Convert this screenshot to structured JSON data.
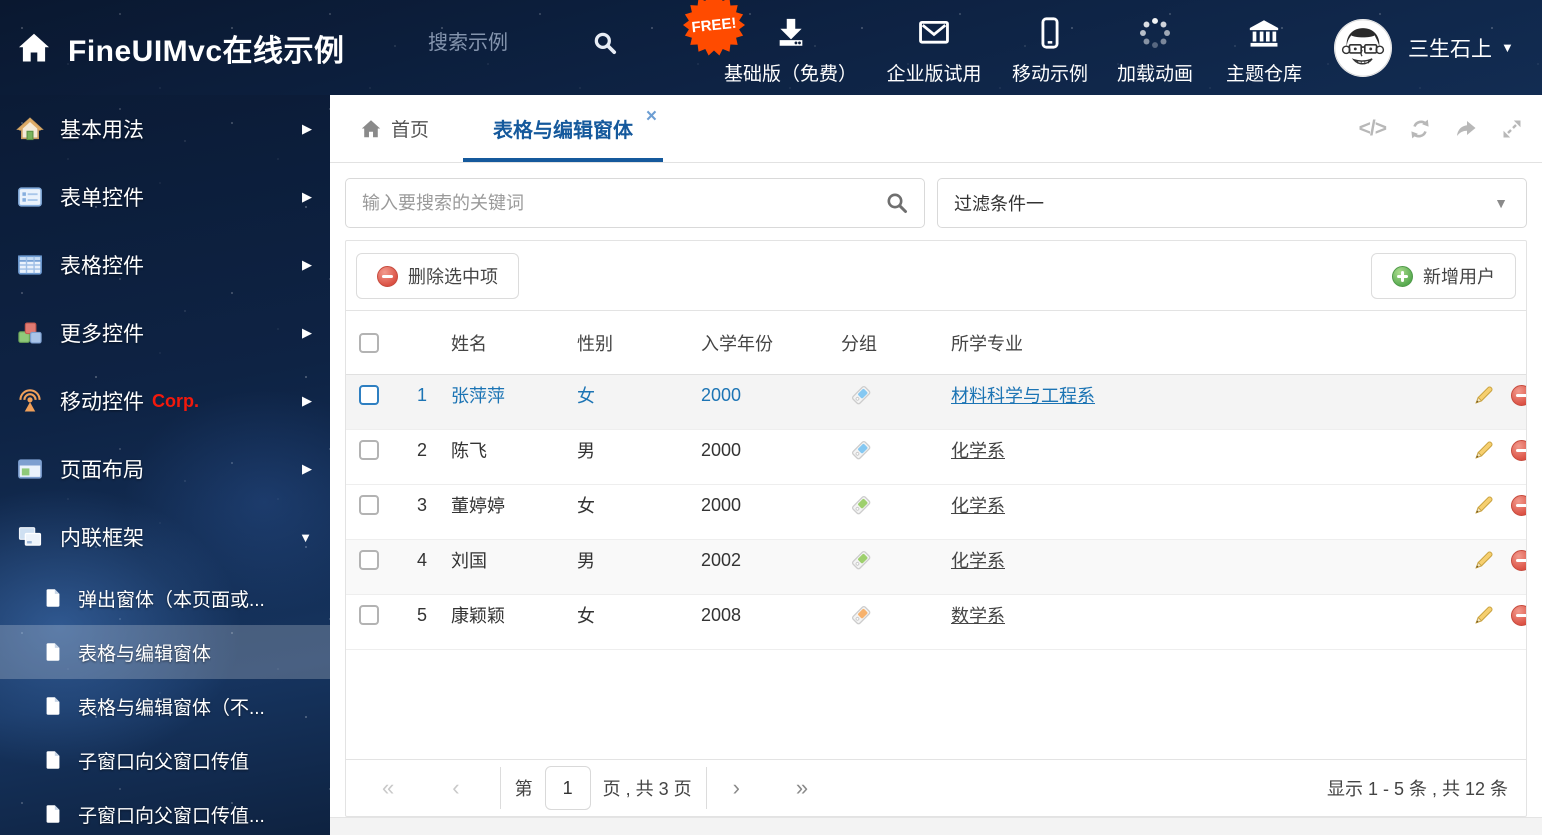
{
  "header": {
    "title": "FineUIMvc在线示例",
    "search_placeholder": "搜索示例",
    "free_badge": "FREE!",
    "nav_items": [
      {
        "label": "基础版（免费）",
        "icon": "download-icon"
      },
      {
        "label": "企业版试用",
        "icon": "mail-icon"
      },
      {
        "label": "移动示例",
        "icon": "mobile-icon"
      },
      {
        "label": "加载动画",
        "icon": "spinner-icon"
      },
      {
        "label": "主题仓库",
        "icon": "bank-icon"
      }
    ],
    "user": {
      "name": "三生石上"
    }
  },
  "sidebar": {
    "items": [
      {
        "label": "基本用法",
        "icon": "home-icon"
      },
      {
        "label": "表单控件",
        "icon": "form-icon"
      },
      {
        "label": "表格控件",
        "icon": "table-icon"
      },
      {
        "label": "更多控件",
        "icon": "cubes-icon"
      },
      {
        "label": "移动控件",
        "badge": "Corp.",
        "icon": "antenna-icon"
      },
      {
        "label": "页面布局",
        "icon": "layout-icon"
      },
      {
        "label": "内联框架",
        "icon": "frames-icon",
        "expanded": true
      }
    ],
    "subitems": [
      {
        "label": "弹出窗体（本页面或..."
      },
      {
        "label": "表格与编辑窗体",
        "active": true
      },
      {
        "label": "表格与编辑窗体（不..."
      },
      {
        "label": "子窗口向父窗口传值"
      },
      {
        "label": "子窗口向父窗口传值..."
      }
    ]
  },
  "tabs": {
    "home": "首页",
    "active": "表格与编辑窗体"
  },
  "filters": {
    "search_placeholder": "输入要搜索的关键词",
    "filter_value": "过滤条件一"
  },
  "buttons": {
    "delete_selected": "删除选中项",
    "add_user": "新增用户"
  },
  "table": {
    "columns": {
      "name": "姓名",
      "gender": "性别",
      "year": "入学年份",
      "group": "分组",
      "major": "所学专业"
    },
    "rows": [
      {
        "num": "1",
        "name": "张萍萍",
        "gender": "女",
        "year": "2000",
        "tag_color": "#85c8f2",
        "major": "材料科学与工程系",
        "selected": true
      },
      {
        "num": "2",
        "name": "陈飞",
        "gender": "男",
        "year": "2000",
        "tag_color": "#85c8f2",
        "major": "化学系"
      },
      {
        "num": "3",
        "name": "董婷婷",
        "gender": "女",
        "year": "2000",
        "tag_color": "#9ed06e",
        "major": "化学系"
      },
      {
        "num": "4",
        "name": "刘国",
        "gender": "男",
        "year": "2002",
        "tag_color": "#9ed06e",
        "major": "化学系"
      },
      {
        "num": "5",
        "name": "康颖颖",
        "gender": "女",
        "year": "2008",
        "tag_color": "#f7b26d",
        "major": "数学系"
      }
    ]
  },
  "pagination": {
    "prefix": "第",
    "current_page": "1",
    "suffix": "页 , 共 3 页",
    "summary": "显示 1 - 5 条 , 共 12 条"
  },
  "glyphs": {
    "code": "</>",
    "close": "×",
    "caret_down": "▼",
    "arrow_right": "▶",
    "pager_first": "«",
    "pager_prev": "‹",
    "pager_next": "›",
    "pager_last": "»"
  },
  "colors": {
    "accent_blue": "#15599c",
    "link_blue": "#1c74b4",
    "danger_red": "#d9534f",
    "success_green": "#5cb85c",
    "badge_orange": "#ff4b00",
    "corp_red": "#f3190c",
    "tag_blue": "#85c8f2",
    "tag_green": "#9ed06e",
    "tag_orange": "#f7b26d"
  }
}
